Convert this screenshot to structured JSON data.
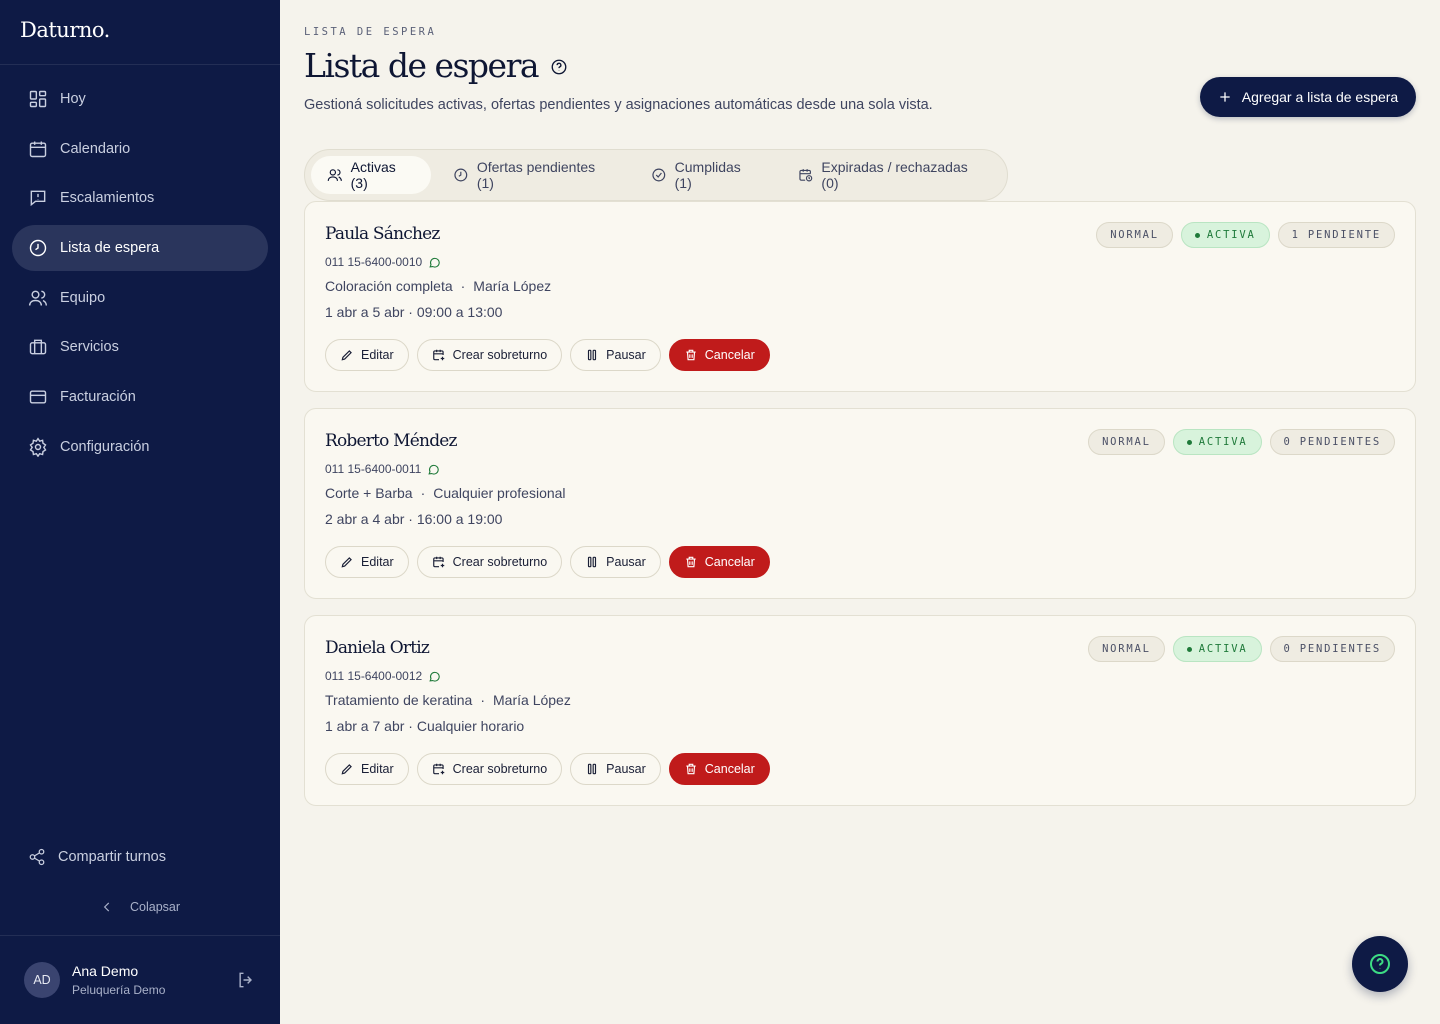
{
  "app": {
    "logo": "Daturno."
  },
  "sidebar": {
    "items": [
      {
        "label": "Hoy",
        "icon": "grid-icon",
        "active": false
      },
      {
        "label": "Calendario",
        "icon": "calendar-icon",
        "active": false
      },
      {
        "label": "Escalamientos",
        "icon": "message-alert-icon",
        "active": false
      },
      {
        "label": "Lista de espera",
        "icon": "clock-icon",
        "active": true
      },
      {
        "label": "Equipo",
        "icon": "users-icon",
        "active": false
      },
      {
        "label": "Servicios",
        "icon": "briefcase-icon",
        "active": false
      },
      {
        "label": "Facturación",
        "icon": "credit-card-icon",
        "active": false
      },
      {
        "label": "Configuración",
        "icon": "gear-icon",
        "active": false
      }
    ],
    "share_label": "Compartir turnos",
    "collapse_label": "Colapsar",
    "user": {
      "initials": "AD",
      "name": "Ana Demo",
      "business": "Peluquería Demo"
    }
  },
  "header": {
    "eyebrow": "LISTA DE ESPERA",
    "title": "Lista de espera",
    "subtitle": "Gestioná solicitudes activas, ofertas pendientes y asignaciones automáticas desde una sola vista.",
    "add_button": "Agregar a lista de espera"
  },
  "tabs": [
    {
      "label": "Activas (3)",
      "icon": "users-icon",
      "active": true
    },
    {
      "label": "Ofertas pendientes (1)",
      "icon": "clock-icon",
      "active": false
    },
    {
      "label": "Cumplidas (1)",
      "icon": "check-circle-icon",
      "active": false
    },
    {
      "label": "Expiradas / rechazadas (0)",
      "icon": "calendar-clock-icon",
      "active": false
    }
  ],
  "actions": {
    "edit": "Editar",
    "overbook": "Crear sobreturno",
    "pause": "Pausar",
    "cancel": "Cancelar"
  },
  "entries": [
    {
      "name": "Paula Sánchez",
      "phone": "011 15-6400-0010",
      "service": "Coloración completa",
      "professional": "María López",
      "dates": "1 abr a 5 abr · 09:00 a 13:00",
      "badges": {
        "priority": "NORMAL",
        "status": "ACTIVA",
        "pending": "1 PENDIENTE"
      }
    },
    {
      "name": "Roberto Méndez",
      "phone": "011 15-6400-0011",
      "service": "Corte + Barba",
      "professional": "Cualquier profesional",
      "dates": "2 abr a 4 abr · 16:00 a 19:00",
      "badges": {
        "priority": "NORMAL",
        "status": "ACTIVA",
        "pending": "0 PENDIENTES"
      }
    },
    {
      "name": "Daniela Ortiz",
      "phone": "011 15-6400-0012",
      "service": "Tratamiento de keratina",
      "professional": "María López",
      "dates": "1 abr a 7 abr · Cualquier horario",
      "badges": {
        "priority": "NORMAL",
        "status": "ACTIVA",
        "pending": "0 PENDIENTES"
      }
    }
  ],
  "colors": {
    "sidebar_bg": "#0e1a45",
    "page_bg": "#f5f3ec",
    "danger": "#c01b1b",
    "active_green": "#1f7a3a",
    "help_accent": "#3ddc84"
  }
}
